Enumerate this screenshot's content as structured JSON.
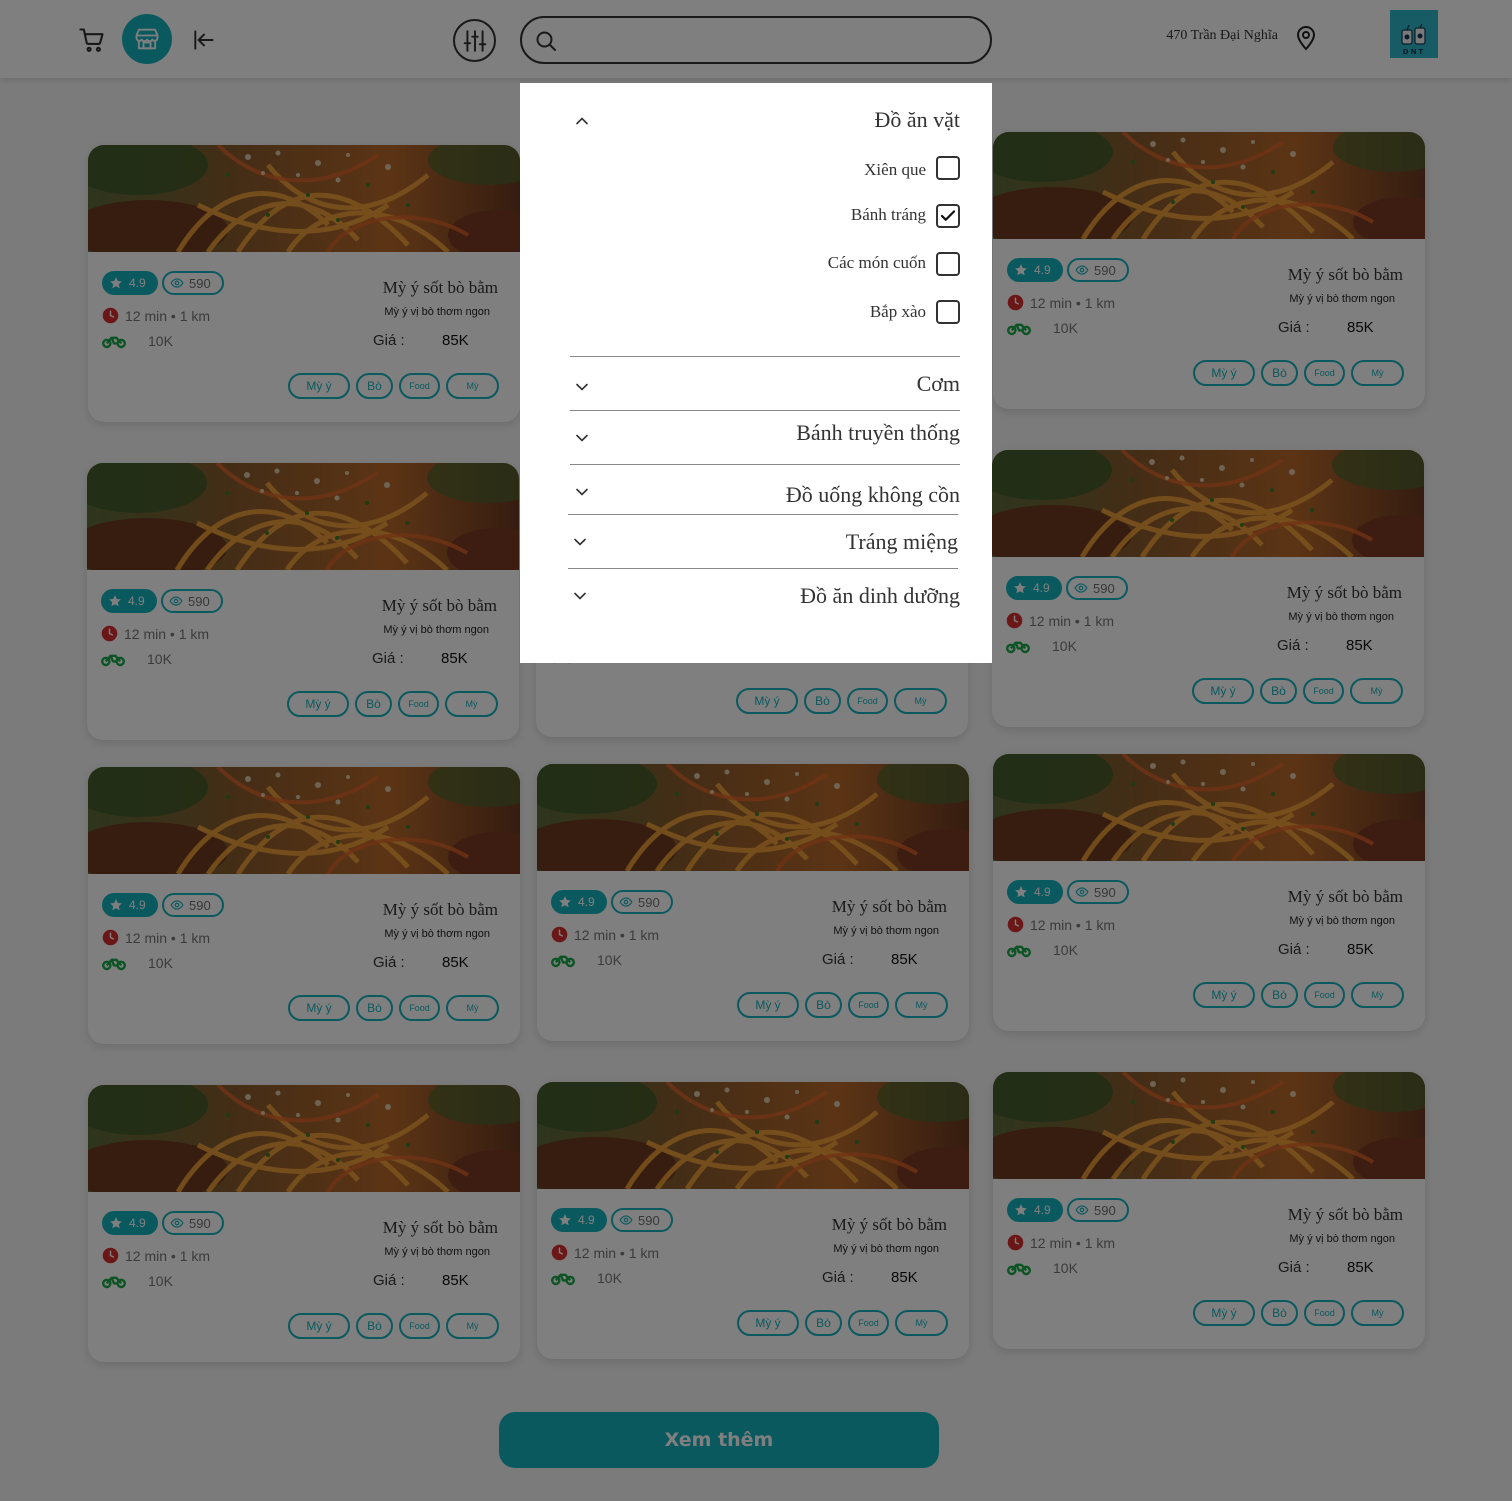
{
  "header": {
    "search_placeholder": "",
    "address": "470 Trần Đại Nghĩa",
    "logo_text": "DNT"
  },
  "colors": {
    "accent": "#14b3bf",
    "clock_red": "#d62f2f",
    "moto_green": "#1aa84a"
  },
  "icons": [
    "cart-icon",
    "store-icon",
    "logout-icon",
    "filter-sliders-icon",
    "search-icon",
    "location-pin-icon",
    "star-icon",
    "eye-icon",
    "clock-icon",
    "motorbike-icon",
    "chevron-up-icon",
    "chevron-down-icon",
    "check-icon"
  ],
  "card": {
    "rating": "4.9",
    "views": "590",
    "time_distance": "12 min • 1 km",
    "ship_fee": "10K",
    "name": "Mỳ ý sốt bò bằm",
    "description": "Mỳ ý vị bò thơm ngon",
    "price_label": "Giá :",
    "price": "85K",
    "tags": [
      "Mỳ ý",
      "Bò",
      "Food",
      "Mỳ"
    ]
  },
  "filter": {
    "open_category": "Đồ ăn vặt",
    "options": [
      {
        "label": "Xiên que",
        "checked": false
      },
      {
        "label": "Bánh tráng",
        "checked": true
      },
      {
        "label": "Các món cuốn",
        "checked": false
      },
      {
        "label": "Bắp xào",
        "checked": false
      }
    ],
    "collapsed_categories": [
      "Cơm",
      "Bánh truyền thống",
      "Đồ uống không cồn",
      "Tráng miệng",
      "Đồ ăn dinh dưỡng"
    ]
  },
  "load_more_label": "Xem thêm"
}
